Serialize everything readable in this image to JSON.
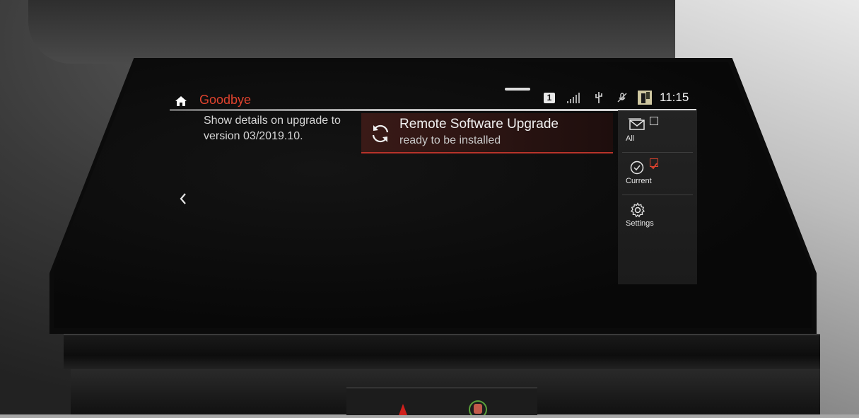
{
  "header": {
    "title": "Goodbye",
    "clock": "11:15",
    "badge": "1",
    "status_icons": [
      "home-icon",
      "signal-strength-icon",
      "usb-plug-icon",
      "microphone-muted-icon",
      "album-art-icon"
    ]
  },
  "message": {
    "lines": [
      "Show details on upgrade to",
      "version 03/2019.10."
    ]
  },
  "notification": {
    "title": "Remote Software Upgrade",
    "subtitle": "ready to be installed",
    "icon": "refresh-icon"
  },
  "side_panel": {
    "items": [
      {
        "label": "All",
        "icon": "envelope-icon",
        "checked": false
      },
      {
        "label": "Current",
        "icon": "clock-icon",
        "checked": true
      },
      {
        "label": "Settings",
        "icon": "gear-icon"
      }
    ]
  },
  "colors": {
    "accent": "#e0432e",
    "text": "#f0f0f0",
    "panel_bg": "#1e1e1e",
    "notification_bg": "#2c1512"
  }
}
